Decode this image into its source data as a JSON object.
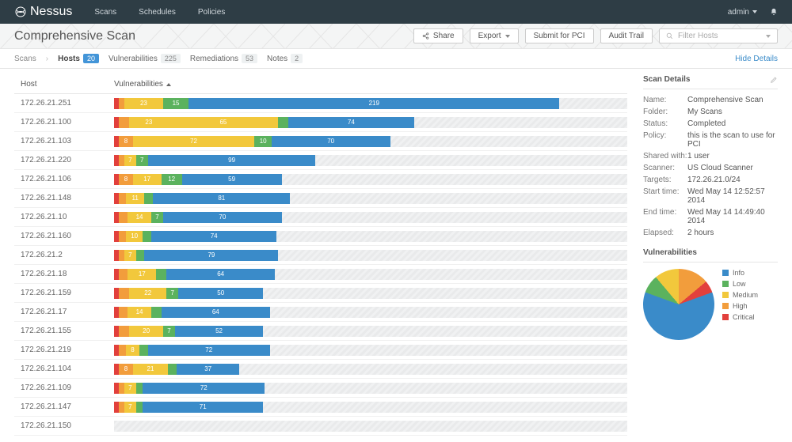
{
  "topnav": {
    "brand": "Nessus",
    "items": [
      "Scans",
      "Schedules",
      "Policies"
    ],
    "user": "admin"
  },
  "subhead": {
    "title": "Comprehensive Scan",
    "share": "Share",
    "export": "Export",
    "pci": "Submit for PCI",
    "audit": "Audit Trail",
    "filter_placeholder": "Filter Hosts"
  },
  "tabs": {
    "crumb": "Scans",
    "hosts": {
      "label": "Hosts",
      "count": "20"
    },
    "vulns": {
      "label": "Vulnerabilities",
      "count": "225"
    },
    "rem": {
      "label": "Remediations",
      "count": "53"
    },
    "notes": {
      "label": "Notes",
      "count": "2"
    },
    "hide": "Hide Details"
  },
  "columns": {
    "host": "Host",
    "vuln": "Vulnerabilities"
  },
  "bar_total": 303,
  "hosts": [
    {
      "ip": "172.26.21.251",
      "crit": 3,
      "high": 3,
      "med": 23,
      "low": 15,
      "info": 219
    },
    {
      "ip": "172.26.21.100",
      "crit": 3,
      "high": 6,
      "med": 23,
      "low_shown": false,
      "med2": 65,
      "low": 6,
      "info": 74
    },
    {
      "ip": "172.26.21.103",
      "crit": 3,
      "high": 8,
      "med": 72,
      "low": 10,
      "info": 70
    },
    {
      "ip": "172.26.21.220",
      "crit": 3,
      "high": 3,
      "med": 7,
      "low": 7,
      "info": 99
    },
    {
      "ip": "172.26.21.106",
      "crit": 3,
      "high": 8,
      "med": 17,
      "low": 12,
      "info": 59
    },
    {
      "ip": "172.26.21.148",
      "crit": 3,
      "high": 4,
      "med": 11,
      "low": 5,
      "info": 81
    },
    {
      "ip": "172.26.21.10",
      "crit": 3,
      "high": 5,
      "med": 14,
      "low": 7,
      "info": 70
    },
    {
      "ip": "172.26.21.160",
      "crit": 3,
      "high": 4,
      "med": 10,
      "low": 5,
      "info": 74
    },
    {
      "ip": "172.26.21.2",
      "crit": 3,
      "high": 3,
      "med": 7,
      "low": 5,
      "info": 79
    },
    {
      "ip": "172.26.21.18",
      "crit": 3,
      "high": 5,
      "med": 17,
      "low": 6,
      "info": 64
    },
    {
      "ip": "172.26.21.159",
      "crit": 3,
      "high": 6,
      "med": 22,
      "low": 7,
      "info": 50
    },
    {
      "ip": "172.26.21.17",
      "crit": 3,
      "high": 5,
      "med": 14,
      "low": 6,
      "info": 64
    },
    {
      "ip": "172.26.21.155",
      "crit": 3,
      "high": 6,
      "med": 20,
      "low": 7,
      "info": 52
    },
    {
      "ip": "172.26.21.219",
      "crit": 3,
      "high": 4,
      "med": 8,
      "low": 5,
      "info": 72
    },
    {
      "ip": "172.26.21.104",
      "crit": 3,
      "high": 8,
      "med": 21,
      "low": 5,
      "info": 37
    },
    {
      "ip": "172.26.21.109",
      "crit": 3,
      "high": 3,
      "med": 7,
      "low": 4,
      "info": 72
    },
    {
      "ip": "172.26.21.147",
      "crit": 3,
      "high": 3,
      "med": 7,
      "low": 4,
      "info": 71
    },
    {
      "ip": "172.26.21.150",
      "crit": 0,
      "high": 0,
      "med": 0,
      "low": 0,
      "info": 0
    }
  ],
  "details": {
    "title": "Scan Details",
    "rows": [
      {
        "k": "Name:",
        "v": "Comprehensive Scan"
      },
      {
        "k": "Folder:",
        "v": "My Scans"
      },
      {
        "k": "Status:",
        "v": "Completed"
      },
      {
        "k": "Policy:",
        "v": "this is the scan to use for PCI"
      },
      {
        "k": "Shared with:",
        "v": "1 user"
      },
      {
        "k": "Scanner:",
        "v": "US Cloud Scanner"
      },
      {
        "k": "Targets:",
        "v": "172.26.21.0/24"
      },
      {
        "k": "Start time:",
        "v": "Wed May 14 12:52:57 2014"
      },
      {
        "k": "End time:",
        "v": "Wed May 14 14:49:40 2014"
      },
      {
        "k": "Elapsed:",
        "v": "2 hours"
      }
    ]
  },
  "vuln_panel": {
    "title": "Vulnerabilities",
    "legend": [
      "Info",
      "Low",
      "Medium",
      "High",
      "Critical"
    ]
  },
  "chart_data": {
    "type": "pie",
    "title": "Vulnerabilities",
    "series": [
      {
        "name": "Info",
        "value": 62,
        "color": "#3a8bc9"
      },
      {
        "name": "Low",
        "value": 8,
        "color": "#5bb25e"
      },
      {
        "name": "Medium",
        "value": 11,
        "color": "#f2c83c"
      },
      {
        "name": "High",
        "value": 14,
        "color": "#f29d3c"
      },
      {
        "name": "Critical",
        "value": 5,
        "color": "#e2403c"
      }
    ]
  }
}
